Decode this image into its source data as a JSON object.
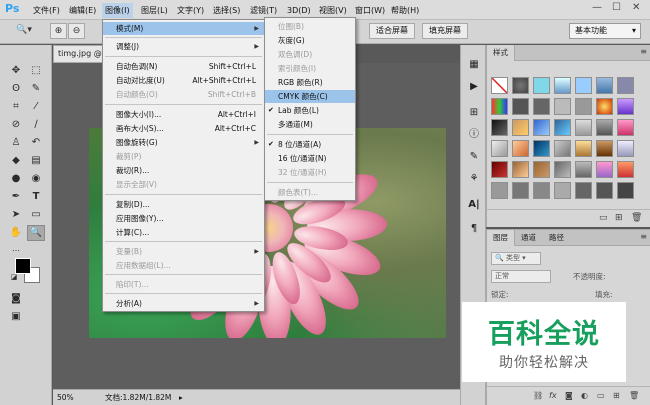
{
  "app": {
    "logo": "Ps"
  },
  "menubar": {
    "items": [
      "文件(F)",
      "编辑(E)",
      "图像(I)",
      "图层(L)",
      "文字(Y)",
      "选择(S)",
      "滤镜(T)",
      "3D(D)",
      "视图(V)",
      "窗口(W)",
      "帮助(H)"
    ],
    "active": "图像(I)",
    "window_controls": [
      "—",
      "☐",
      "✕"
    ]
  },
  "optionsbar": {
    "fit_screen": "适合屏幕",
    "fill_screen": "填充屏幕",
    "workspace": "基本功能"
  },
  "document": {
    "tab": "timg.jpg @",
    "zoom": "50%",
    "info": "文档:1.82M/1.82M"
  },
  "image_menu": {
    "items": [
      {
        "label": "模式(M)",
        "shortcut": "",
        "submenu": true,
        "disabled": false
      },
      {
        "label": "调整(J)",
        "shortcut": "",
        "submenu": true,
        "disabled": false
      },
      {
        "label": "自动色调(N)",
        "shortcut": "Shift+Ctrl+L",
        "submenu": false,
        "disabled": false
      },
      {
        "label": "自动对比度(U)",
        "shortcut": "Alt+Shift+Ctrl+L",
        "submenu": false,
        "disabled": false
      },
      {
        "label": "自动颜色(O)",
        "shortcut": "Shift+Ctrl+B",
        "submenu": false,
        "disabled": true
      },
      {
        "label": "图像大小(I)...",
        "shortcut": "Alt+Ctrl+I",
        "submenu": false,
        "disabled": false
      },
      {
        "label": "画布大小(S)...",
        "shortcut": "Alt+Ctrl+C",
        "submenu": false,
        "disabled": false
      },
      {
        "label": "图像旋转(G)",
        "shortcut": "",
        "submenu": true,
        "disabled": false
      },
      {
        "label": "裁剪(P)",
        "shortcut": "",
        "submenu": false,
        "disabled": true
      },
      {
        "label": "裁切(R)...",
        "shortcut": "",
        "submenu": false,
        "disabled": false
      },
      {
        "label": "显示全部(V)",
        "shortcut": "",
        "submenu": false,
        "disabled": true
      },
      {
        "label": "复制(D)...",
        "shortcut": "",
        "submenu": false,
        "disabled": false
      },
      {
        "label": "应用图像(Y)...",
        "shortcut": "",
        "submenu": false,
        "disabled": false
      },
      {
        "label": "计算(C)...",
        "shortcut": "",
        "submenu": false,
        "disabled": false
      },
      {
        "label": "变量(B)",
        "shortcut": "",
        "submenu": true,
        "disabled": true
      },
      {
        "label": "应用数据组(L)...",
        "shortcut": "",
        "submenu": false,
        "disabled": true
      },
      {
        "label": "陷印(T)...",
        "shortcut": "",
        "submenu": false,
        "disabled": true
      },
      {
        "label": "分析(A)",
        "shortcut": "",
        "submenu": true,
        "disabled": false
      }
    ]
  },
  "mode_menu": {
    "items": [
      {
        "label": "位图(B)",
        "disabled": true,
        "checked": false,
        "submenu": false
      },
      {
        "label": "灰度(G)",
        "disabled": false,
        "checked": false,
        "submenu": false
      },
      {
        "label": "双色调(D)",
        "disabled": true,
        "checked": false,
        "submenu": false
      },
      {
        "label": "索引颜色(I)",
        "disabled": true,
        "checked": false,
        "submenu": false
      },
      {
        "label": "RGB 颜色(R)",
        "disabled": false,
        "checked": false,
        "submenu": false
      },
      {
        "label": "CMYK 颜色(C)",
        "disabled": false,
        "checked": false,
        "submenu": false,
        "highlighted": true
      },
      {
        "label": "Lab 颜色(L)",
        "disabled": false,
        "checked": true,
        "submenu": false
      },
      {
        "label": "多通道(M)",
        "disabled": false,
        "checked": false,
        "submenu": false
      },
      {
        "label": "8 位/通道(A)",
        "disabled": false,
        "checked": true,
        "submenu": false
      },
      {
        "label": "16 位/通道(N)",
        "disabled": false,
        "checked": false,
        "submenu": false
      },
      {
        "label": "32 位/通道(H)",
        "disabled": true,
        "checked": false,
        "submenu": false
      },
      {
        "label": "颜色表(T)...",
        "disabled": true,
        "checked": false,
        "submenu": false
      }
    ]
  },
  "styles_panel": {
    "tab": "样式"
  },
  "layers_panel": {
    "tabs": [
      "图层",
      "通道",
      "路径"
    ],
    "filter_label": "类型",
    "blend_mode": "正常",
    "opacity_label": "不透明度:",
    "lock_label": "锁定:",
    "fill_label": "填充:"
  },
  "watermark": {
    "title": "百科全说",
    "subtitle": "助你轻松解决"
  },
  "colors": {
    "menu_highlight": "#9cc3ea",
    "brand": "#2fa3f2",
    "watermark_green": "#17a05d"
  }
}
